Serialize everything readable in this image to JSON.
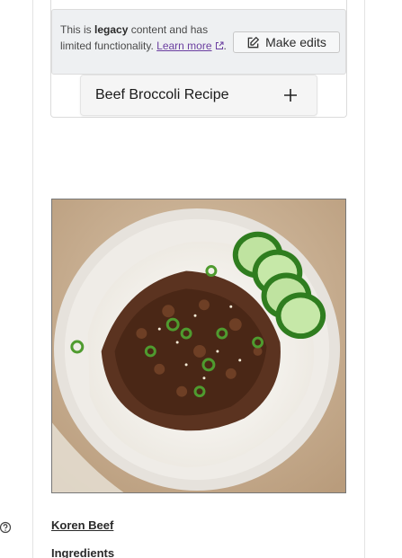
{
  "legacy_notice": {
    "prefix": "This is ",
    "bold_word": "legacy",
    "suffix": " content and has limited functionality. ",
    "learn_link": "Learn more",
    "end": ".",
    "external_icon": "external-link-icon"
  },
  "make_edits_button": {
    "label": "Make edits",
    "icon": "edit-icon"
  },
  "accordion": {
    "title": "Beef Broccoli Recipe",
    "icon": "plus-icon"
  },
  "recipe_image": {
    "subject": "ground beef over rice with green onions, sesame seeds and cucumber slices"
  },
  "help": {
    "icon": "help-circle-icon"
  },
  "recipe": {
    "title": "Koren Beef",
    "section_heading": "Ingredients"
  },
  "colors": {
    "link": "#6b3fa0",
    "banner_bg": "#eef0f2",
    "accordion_bg": "#f5f5f5"
  }
}
